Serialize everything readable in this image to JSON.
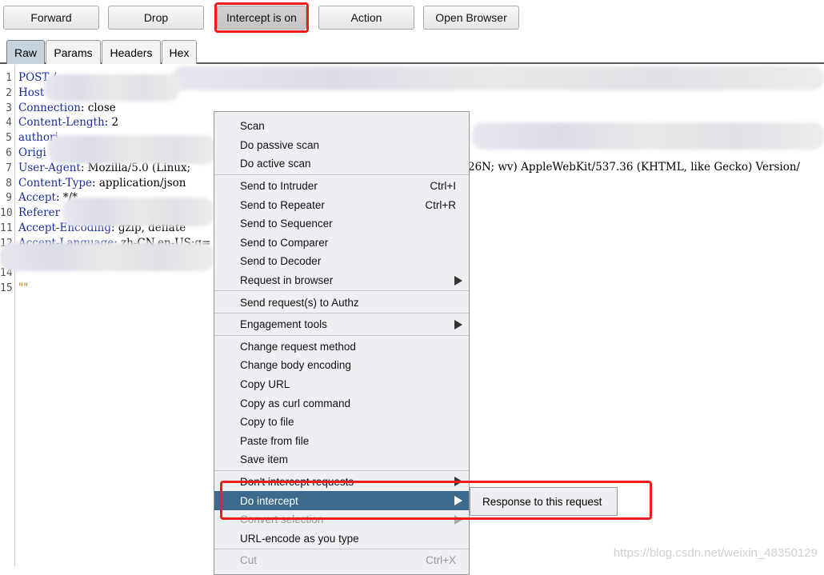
{
  "toolbar": {
    "forward": "Forward",
    "drop": "Drop",
    "intercept": "Intercept is on",
    "action": "Action",
    "open_browser": "Open Browser"
  },
  "tabs": [
    "Raw",
    "Params",
    "Headers",
    "Hex"
  ],
  "editor": {
    "lines": [
      {
        "n": "1",
        "key": "POST",
        "rest": " /..."
      },
      {
        "n": "2",
        "key": "Host",
        "rest": ""
      },
      {
        "n": "3",
        "key": "Connection",
        "rest": ": close"
      },
      {
        "n": "4",
        "key": "Content-Length",
        "rest": ": 2"
      },
      {
        "n": "5",
        "key": "authori",
        "rest": ""
      },
      {
        "n": "6",
        "key": "Origi",
        "rest": ""
      },
      {
        "n": "7",
        "key": "User-Agent",
        "rest": ": Mozilla/5.0 (Linux;"
      },
      {
        "n": "8",
        "key": "Content-Type",
        "rest": ": application/json"
      },
      {
        "n": "9",
        "key": "Accept",
        "rest": ": */*"
      },
      {
        "n": "10",
        "key": "Referer",
        "rest": ""
      },
      {
        "n": "11",
        "key": "Accept-Encoding",
        "rest": ": gzip, deflate"
      },
      {
        "n": "12",
        "key": "Accept-Language",
        "rest": ": zh-CN,en-US;q="
      },
      {
        "n": "13",
        "key": "",
        "rest": ""
      },
      {
        "n": "14",
        "key": "",
        "rest": ""
      },
      {
        "n": "15",
        "key": "\"\"",
        "rest": ""
      }
    ],
    "line7_tail": "26N; wv) AppleWebKit/537.36 (KHTML, like Gecko) Version/"
  },
  "menu": {
    "items": [
      {
        "label": "Scan"
      },
      {
        "label": "Do passive scan"
      },
      {
        "label": "Do active scan"
      },
      {
        "sep": true
      },
      {
        "label": "Send to Intruder",
        "shortcut": "Ctrl+I"
      },
      {
        "label": "Send to Repeater",
        "shortcut": "Ctrl+R"
      },
      {
        "label": "Send to Sequencer"
      },
      {
        "label": "Send to Comparer"
      },
      {
        "label": "Send to Decoder"
      },
      {
        "label": "Request in browser",
        "submenu": true
      },
      {
        "sep": true
      },
      {
        "label": "Send request(s) to Authz"
      },
      {
        "sep": true
      },
      {
        "label": "Engagement tools",
        "submenu": true
      },
      {
        "sep": true
      },
      {
        "label": "Change request method"
      },
      {
        "label": "Change body encoding"
      },
      {
        "label": "Copy URL"
      },
      {
        "label": "Copy as curl command"
      },
      {
        "label": "Copy to file"
      },
      {
        "label": "Paste from file"
      },
      {
        "label": "Save item"
      },
      {
        "sep": true
      },
      {
        "label": "Don't intercept requests",
        "submenu": true
      },
      {
        "label": "Do intercept",
        "submenu": true,
        "highlighted": true
      },
      {
        "label": "Convert selection",
        "submenu": true,
        "disabled": true
      },
      {
        "label": "URL-encode as you type"
      },
      {
        "sep": true
      },
      {
        "label": "Cut",
        "shortcut": "Ctrl+X",
        "disabled": true
      }
    ]
  },
  "submenu": {
    "label": "Response to this request"
  },
  "watermark": "https://blog.csdn.net/weixin_48350129",
  "colors": {
    "highlight": "#3b6a8c",
    "annotation": "#ee1c1c"
  }
}
